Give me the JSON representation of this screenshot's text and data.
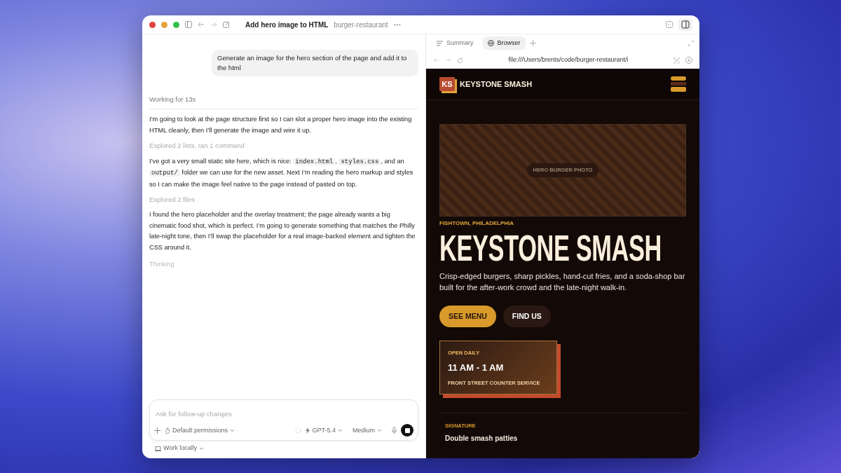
{
  "window": {
    "title": "Add hero image to HTML",
    "project": "burger-restaurant"
  },
  "chat": {
    "user_message": "Generate an image for the hero section of the page and add it to the html",
    "status": "Working for 13s",
    "items": [
      {
        "kind": "message",
        "segments": [
          {
            "kind": "text",
            "text": "I’m going to look at the page structure first so I can slot a proper hero image into the existing HTML cleanly, then I’ll generate the image and wire it up."
          }
        ]
      },
      {
        "kind": "activity",
        "text": "Explored 2 lists, ran 1 command"
      },
      {
        "kind": "message",
        "segments": [
          {
            "kind": "text",
            "text": "I’ve got a very small static site here, which is nice: "
          },
          {
            "kind": "code",
            "text": "index.html"
          },
          {
            "kind": "text",
            "text": ", "
          },
          {
            "kind": "code",
            "text": "styles.css"
          },
          {
            "kind": "text",
            "text": ", and an "
          },
          {
            "kind": "code",
            "text": "output/"
          },
          {
            "kind": "text",
            "text": " folder we can use for the new asset. Next I’m reading the hero markup and styles so I can make the image feel native to the page instead of pasted on top."
          }
        ]
      },
      {
        "kind": "activity",
        "text": "Explored 2 files"
      },
      {
        "kind": "message",
        "segments": [
          {
            "kind": "text",
            "text": "I found the hero placeholder and the overlay treatment; the page already wants a big cinematic food shot, which is perfect. I’m going to generate something that matches the Philly late-night tone, then I’ll swap the placeholder for a real image-backed element and tighten the CSS around it."
          }
        ]
      }
    ],
    "thinking": "Thinking"
  },
  "composer": {
    "placeholder": "Ask for follow-up changes",
    "permissions": "Default permissions",
    "model": "GPT-5.4",
    "effort": "Medium",
    "work_mode": "Work locally"
  },
  "panel": {
    "tabs": [
      {
        "label": "Summary",
        "selected": false
      },
      {
        "label": "Browser",
        "selected": true
      }
    ],
    "url": "file:///Users/brents/code/burger-restaurant/i"
  },
  "site": {
    "logo": "KS",
    "brand": "KEYSTONE SMASH",
    "hero_image_label": "HERO BURGER PHOTO",
    "location": "FISHTOWN, PHILADELPHIA",
    "heading": "KEYSTONE SMASH",
    "description": "Crisp-edged burgers, sharp pickles, hand-cut fries, and a soda-shop bar built for the after-work crowd and the late-night walk-in.",
    "buttons": [
      {
        "label": "SEE MENU",
        "kind": "primary"
      },
      {
        "label": "FIND US",
        "kind": "secondary"
      }
    ],
    "hours": {
      "label": "OPEN DAILY",
      "time": "11 AM - 1 AM",
      "note": "FRONT STREET COUNTER SERVICE"
    },
    "signature": {
      "label": "SIGNATURE",
      "text": "Double smash patties"
    }
  }
}
